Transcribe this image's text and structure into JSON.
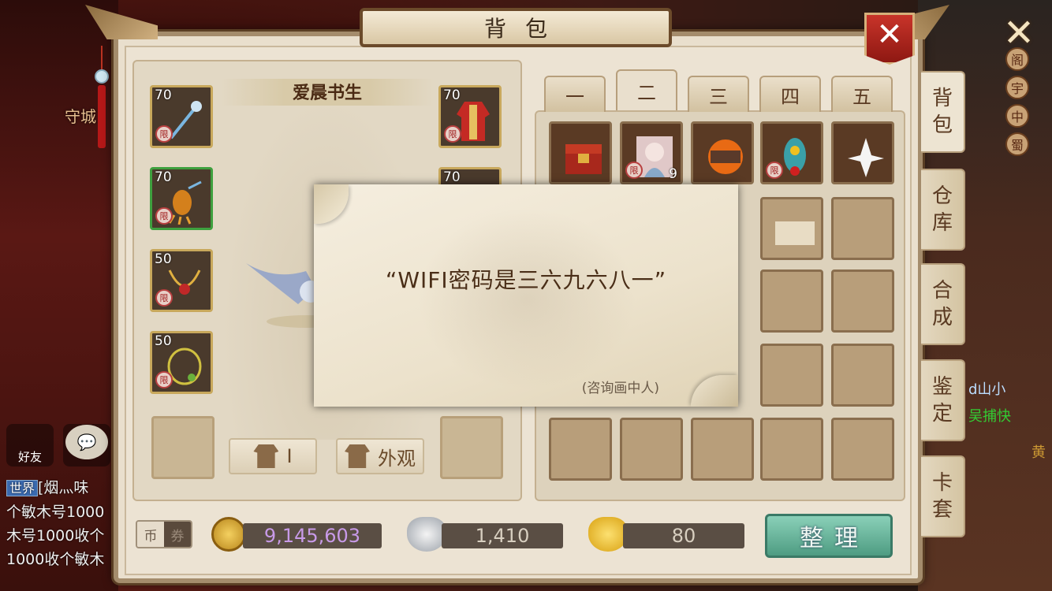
{
  "window": {
    "title": "背包",
    "close_symbol": "✕",
    "exit_symbol": "✕"
  },
  "world": {
    "guard_label": "守城",
    "right_banner": [
      "阁",
      "宇",
      "中",
      "蜀"
    ],
    "social": {
      "friends_label": "好友",
      "chat_icon": "💬"
    },
    "chat_lines": [
      {
        "tag": "世界",
        "text": "[烟灬味"
      },
      {
        "text": "个敏木号1000"
      },
      {
        "text": "木号1000收个"
      },
      {
        "text": "1000收个敏木"
      }
    ],
    "right_side_lines": [
      "d山小",
      "吴捕快",
      "黄"
    ]
  },
  "equipment": {
    "character_name": "爱晨书生",
    "left_slots": [
      {
        "level": "70",
        "item": "staff",
        "border": "gold"
      },
      {
        "level": "70",
        "item": "claw",
        "border": "green"
      },
      {
        "level": "50",
        "item": "necklace",
        "border": "gold"
      },
      {
        "level": "50",
        "item": "belt",
        "border": "gold"
      }
    ],
    "right_slots": [
      {
        "level": "70",
        "item": "robe",
        "border": "gold"
      },
      {
        "level": "70",
        "item": "hat",
        "border": "gold"
      }
    ],
    "seal_char": "限",
    "armor_button_label": "I",
    "appearance_button_label": "外观"
  },
  "bag": {
    "tabs": [
      "一",
      "二",
      "三",
      "四",
      "五"
    ],
    "active_tab": 1,
    "side_tabs": [
      {
        "label": "背\n包",
        "active": true
      },
      {
        "label": "仓\n库",
        "active": false
      },
      {
        "label": "合\n成",
        "active": false
      },
      {
        "label": "鉴\n定",
        "active": false
      },
      {
        "label": "卡\n套",
        "active": false
      }
    ],
    "row1_items": [
      {
        "item": "treasure-chest",
        "count": ""
      },
      {
        "item": "character-card",
        "count": "9"
      },
      {
        "item": "fire-scroll",
        "count": ""
      },
      {
        "item": "flower-garland",
        "count": ""
      },
      {
        "item": "white-lily",
        "count": ""
      }
    ],
    "row2_visible_item": "paper-scroll"
  },
  "currency": {
    "toggle_on": "币",
    "toggle_off": "券",
    "coins": "9,145,603",
    "silver": "1,410",
    "gold": "80",
    "sort_label": "整理"
  },
  "dialog": {
    "message": "“WIFI密码是三六九六八一”",
    "source": "(咨询画中人)"
  }
}
